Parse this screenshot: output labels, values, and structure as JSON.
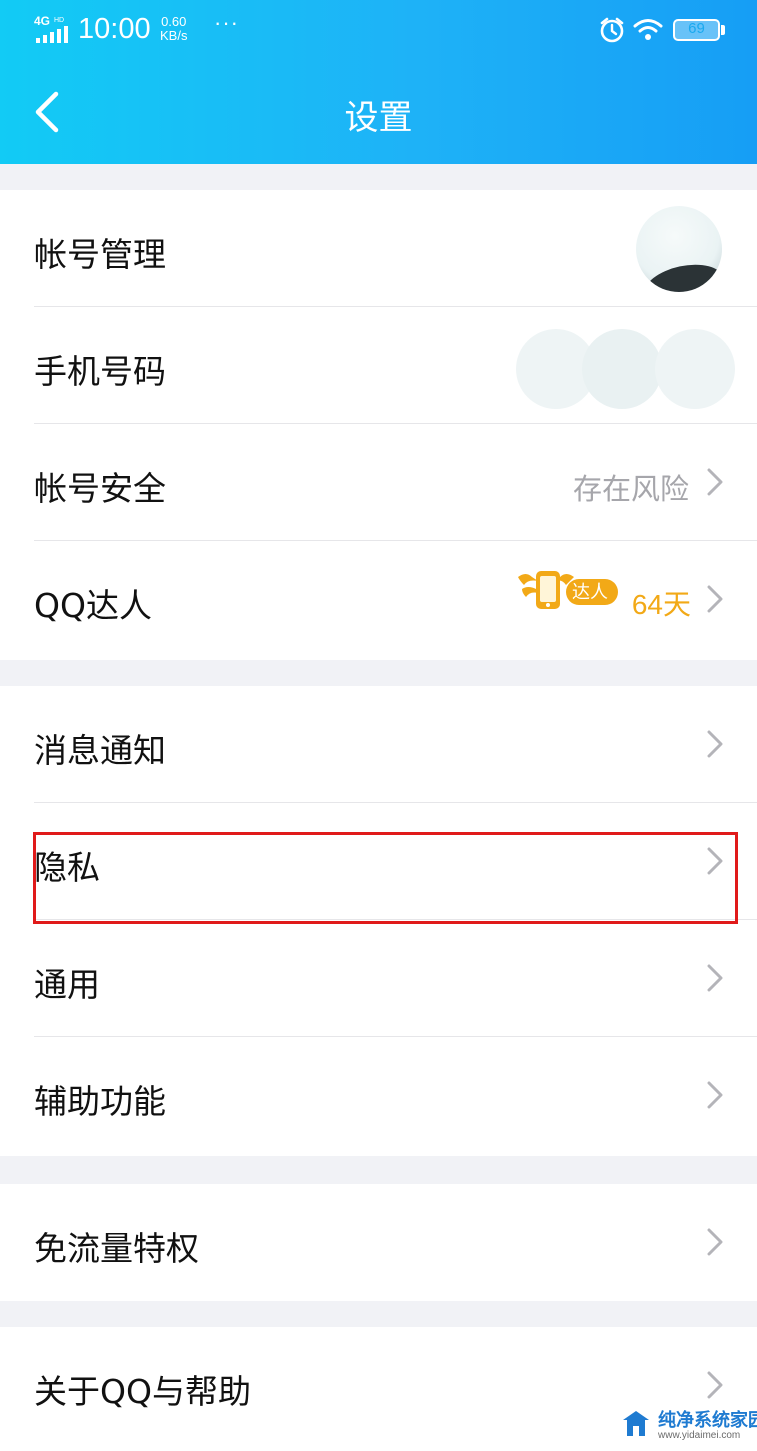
{
  "status_bar": {
    "network": "4G HD",
    "time": "10:00",
    "speed_value": "0.60",
    "speed_unit": "KB/s",
    "more": "···",
    "battery": "69"
  },
  "nav": {
    "title": "设置"
  },
  "groups": [
    {
      "items": [
        {
          "label": "帐号管理"
        },
        {
          "label": "手机号码"
        },
        {
          "label": "帐号安全",
          "value": "存在风险"
        },
        {
          "label": "QQ达人",
          "badge": "达人",
          "value": "64天"
        }
      ]
    },
    {
      "items": [
        {
          "label": "消息通知"
        },
        {
          "label": "隐私",
          "highlighted": true
        },
        {
          "label": "通用"
        },
        {
          "label": "辅助功能"
        }
      ]
    },
    {
      "items": [
        {
          "label": "免流量特权"
        }
      ]
    },
    {
      "items": [
        {
          "label": "关于QQ与帮助"
        }
      ]
    }
  ],
  "watermark": {
    "name": "纯净系统家园",
    "url": "www.yidaimei.com"
  },
  "colors": {
    "header_start": "#12cbf5",
    "header_end": "#169ef5",
    "badge_gold": "#f2a917",
    "highlight_red": "#e01a1a"
  }
}
